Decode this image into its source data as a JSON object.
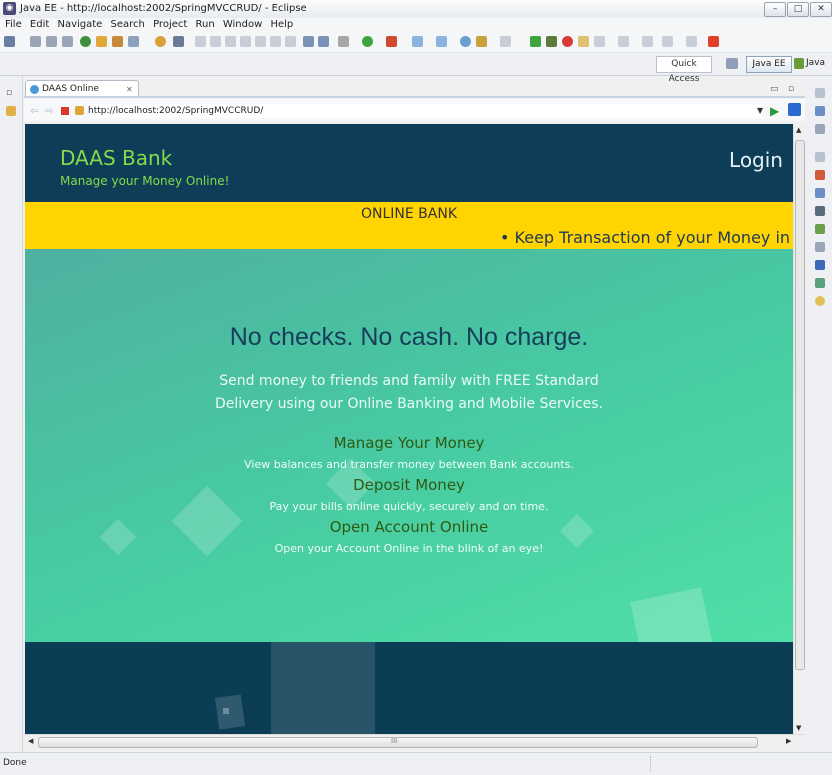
{
  "window": {
    "title": "Java EE - http://localhost:2002/SpringMVCCRUD/ - Eclipse",
    "min": "–",
    "max": "□",
    "close": "✕"
  },
  "menu": [
    "File",
    "Edit",
    "Navigate",
    "Search",
    "Project",
    "Run",
    "Window",
    "Help"
  ],
  "perspectives": {
    "quick_access": "Quick Access",
    "java_ee": "Java EE",
    "java": "Java"
  },
  "editor": {
    "tab_label": "DAAS Online Banking",
    "tab_close": "✕",
    "url": "http://localhost:2002/SpringMVCCRUD/"
  },
  "site": {
    "brand": "DAAS Bank",
    "tagline": "Manage your Money Online!",
    "login": "Login",
    "banner_title": "ONLINE BANK",
    "marquee": "•  Keep Transaction of your Money in blink of",
    "headline": "No checks. No cash. No charge.",
    "subline": "Send money to friends and family with FREE Standard Delivery using our Online Banking and Mobile Services.",
    "features": [
      {
        "title": "Manage Your Money",
        "desc": "View balances and transfer money between Bank accounts."
      },
      {
        "title": "Deposit Money",
        "desc": "Pay your bills online quickly, securely and on time."
      },
      {
        "title": "Open Account Online",
        "desc": "Open your Account Online in the blink of an eye!"
      }
    ]
  },
  "scroll": {
    "h_center": "III"
  },
  "status": {
    "text": "Done"
  },
  "colors": {
    "accent_green": "#86d94a",
    "banner_yellow": "#ffd400",
    "dark_navy": "#0d3d57",
    "feature_title": "#2f5a10"
  }
}
